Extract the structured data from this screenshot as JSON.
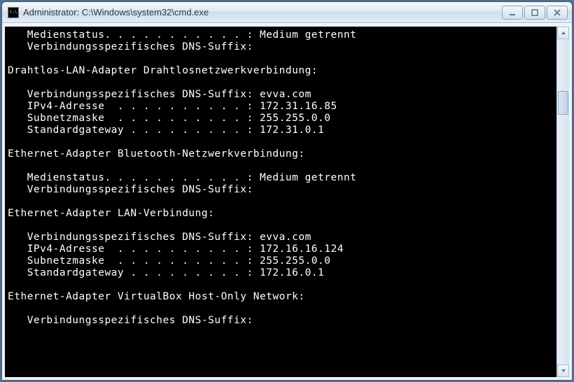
{
  "window": {
    "title": "Administrator: C:\\Windows\\system32\\cmd.exe"
  },
  "console": {
    "lines": [
      "   Medienstatus. . . . . . . . . . . : Medium getrennt",
      "   Verbindungsspezifisches DNS-Suffix:",
      "",
      "Drahtlos-LAN-Adapter Drahtlosnetzwerkverbindung:",
      "",
      "   Verbindungsspezifisches DNS-Suffix: evva.com",
      "   IPv4-Adresse  . . . . . . . . . . : 172.31.16.85",
      "   Subnetzmaske  . . . . . . . . . . : 255.255.0.0",
      "   Standardgateway . . . . . . . . . : 172.31.0.1",
      "",
      "Ethernet-Adapter Bluetooth-Netzwerkverbindung:",
      "",
      "   Medienstatus. . . . . . . . . . . : Medium getrennt",
      "   Verbindungsspezifisches DNS-Suffix:",
      "",
      "Ethernet-Adapter LAN-Verbindung:",
      "",
      "   Verbindungsspezifisches DNS-Suffix: evva.com",
      "   IPv4-Adresse  . . . . . . . . . . : 172.16.16.124",
      "   Subnetzmaske  . . . . . . . . . . : 255.255.0.0",
      "   Standardgateway . . . . . . . . . : 172.16.0.1",
      "",
      "Ethernet-Adapter VirtualBox Host-Only Network:",
      "",
      "   Verbindungsspezifisches DNS-Suffix:"
    ]
  }
}
